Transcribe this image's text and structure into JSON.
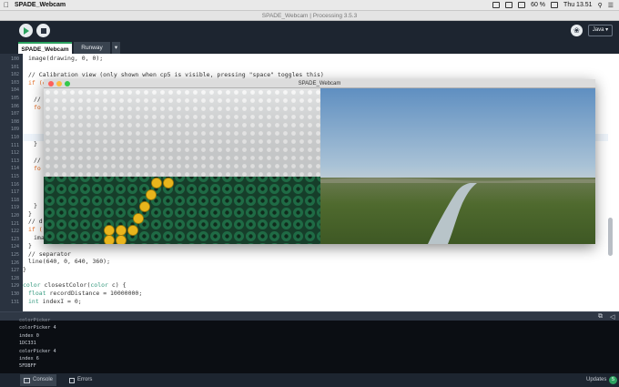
{
  "menubar": {
    "apple": "",
    "app": "SPADE_Webcam",
    "battery": "60 %",
    "time": "Thu 13.51"
  },
  "window": {
    "title": "SPADE_Webcam | Processing 3.5.3"
  },
  "toolbar": {
    "mode": "Java"
  },
  "tabs": [
    {
      "label": "SPADE_Webcam"
    },
    {
      "label": "Runway"
    }
  ],
  "tab_menu": "▾",
  "gutter": [
    "100",
    "101",
    "102",
    "103",
    "104",
    "105",
    "106",
    "107",
    "108",
    "109",
    "110",
    "111",
    "112",
    "113",
    "114",
    "115",
    "116",
    "117",
    "118",
    "119",
    "120",
    "121",
    "122",
    "123",
    "124",
    "125",
    "126",
    "127",
    "128",
    "129",
    "130",
    "131"
  ],
  "code": {
    "l100": "image(drawing, 0, 0);",
    "l102": "// Calibration view (only shown when cp5 is visible, pressing \"space\" toggles this)",
    "l103": "if (c",
    "l105": "//",
    "l106": "fo",
    "l111": "}",
    "l113": "//",
    "l114": "fo",
    "l119": "}",
    "l120": "}",
    "l121": "// d",
    "l122": "if (",
    "l123": "ima",
    "l124": "}",
    "l125": "// separator",
    "l126": "line(640, 0, 640, 360);",
    "l127": "}",
    "l129a": "color",
    "l129b": " closestColor(",
    "l129c": "color",
    "l129d": " c) {",
    "l130a": "float",
    "l130b": " recordDistance = 10000000;",
    "l131a": "int",
    "l131b": " indexI = 0;"
  },
  "sketch": {
    "title": "SPADE_Webcam"
  },
  "console": [
    "colorPicker 4",
    "index 0",
    "1DC331",
    "colorPicker 4",
    "index 6",
    "5FDBFF"
  ],
  "console_partial": "colorPicker",
  "bottom_tabs": {
    "console": "Console",
    "errors": "Errors"
  },
  "status": {
    "updates": "Updates",
    "count": "5"
  },
  "colors": {
    "accent": "#2ca25f",
    "editor_bg": "#ffffff",
    "gutter": "#2a3340",
    "chrome": "#1d2530",
    "keyword": "#e2661a",
    "type_keyword": "#33997e"
  }
}
